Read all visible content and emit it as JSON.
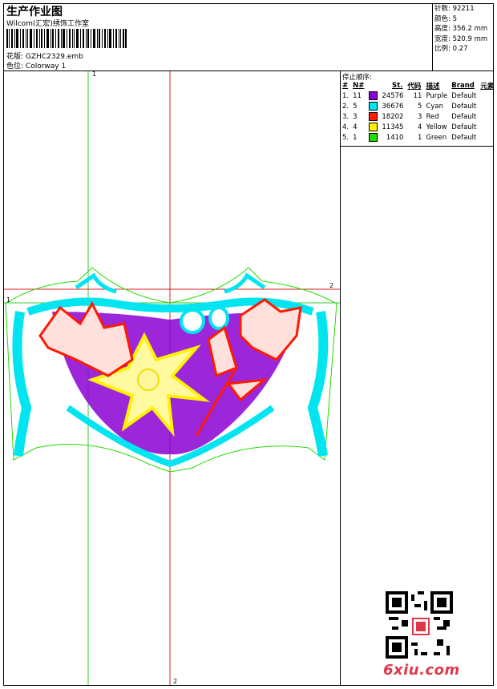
{
  "header": {
    "title": "生产作业图",
    "company": "Wilcom(汇宏)绣饰工作室",
    "design_label": "花版:",
    "design_value": "GZHC2329.emb",
    "colorway_label": "色位:",
    "colorway_value": "Colorway 1"
  },
  "stats": [
    {
      "label": "针数:",
      "value": "92211"
    },
    {
      "label": "颜色:",
      "value": "5"
    },
    {
      "label": "高度:",
      "value": "356.2 mm"
    },
    {
      "label": "宽度:",
      "value": "520.9 mm"
    },
    {
      "label": "比例:",
      "value": "0.27"
    }
  ],
  "stop_sequence": {
    "title": "停止顺序:",
    "headers": [
      "#",
      "N#",
      "St.",
      "代码",
      "描述",
      "Brand",
      "元素"
    ],
    "rows": [
      {
        "idx": "1.",
        "n": "11",
        "color": "#8a00d4",
        "st": "24576",
        "code": "11",
        "desc": "Purple",
        "brand": "Default"
      },
      {
        "idx": "2.",
        "n": "5",
        "color": "#00e5f0",
        "st": "36676",
        "code": "5",
        "desc": "Cyan",
        "brand": "Default"
      },
      {
        "idx": "3.",
        "n": "3",
        "color": "#ff1a00",
        "st": "18202",
        "code": "3",
        "desc": "Red",
        "brand": "Default"
      },
      {
        "idx": "4.",
        "n": "4",
        "color": "#fff200",
        "st": "11345",
        "code": "4",
        "desc": "Yellow",
        "brand": "Default"
      },
      {
        "idx": "5.",
        "n": "1",
        "color": "#22dd00",
        "st": "1410",
        "code": "1",
        "desc": "Green",
        "brand": "Default"
      }
    ]
  },
  "axes": {
    "v1": "1",
    "v2": "2",
    "h1": "1",
    "h2": "2"
  },
  "watermark": "6xiu.com",
  "colors": {
    "purple": "#8a00d4",
    "cyan": "#00e5f0",
    "red": "#ff1a00",
    "yellow": "#fff200",
    "green": "#22dd00"
  }
}
